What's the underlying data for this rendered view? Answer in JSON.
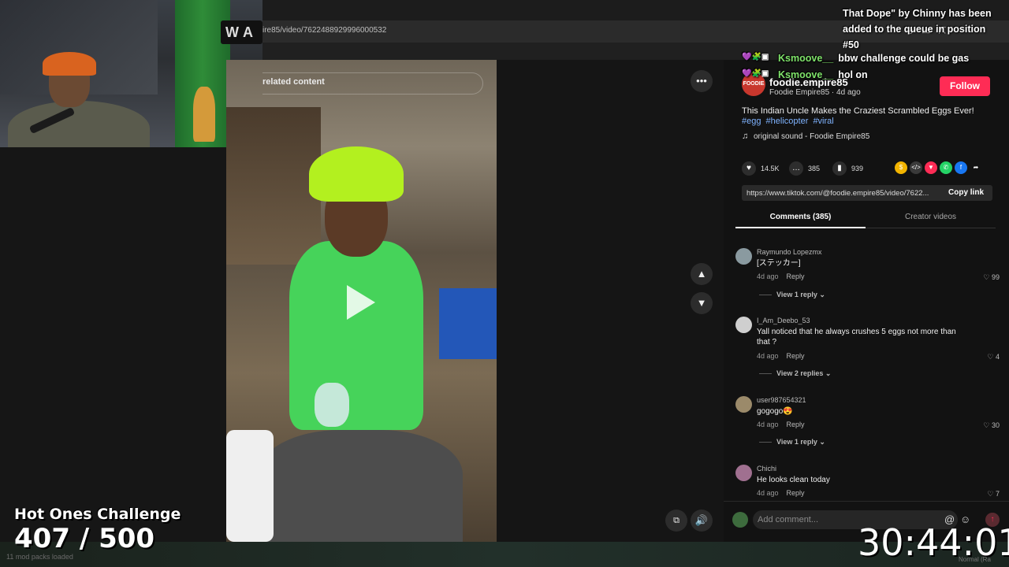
{
  "browser": {
    "url": "ire85/video/7622488929996000532"
  },
  "video": {
    "related_label": "related content",
    "more_label": "•••"
  },
  "stream_overlay": {
    "challenge_title": "Hot Ones Challenge",
    "challenge_count": "407 / 500",
    "mods_loaded": "11 mod packs loaded",
    "timer": "30:44:01",
    "normal_label": "Normal (Ra"
  },
  "chat": {
    "queue_message": "That Dope\" by Chinny has been added to the queue in position #50",
    "messages": [
      {
        "user": "Ksmoove__",
        "text": "bbw challenge could be gas"
      },
      {
        "user": "Ksmoove__",
        "text": "hol on"
      }
    ]
  },
  "creator": {
    "avatar_text": "FOODIE",
    "username": "foodie.empire85",
    "nickname_date": "Foodie Empire85 · 4d ago",
    "follow_label": "Follow"
  },
  "post": {
    "description": "This Indian Uncle Makes the Craziest Scrambled Eggs Ever!",
    "hashtags": [
      "#egg",
      "#helicopter",
      "#viral"
    ],
    "music": "original sound - Foodie Empire85",
    "likes": "14.5K",
    "comments": "385",
    "saves": "939",
    "link": "https://www.tiktok.com/@foodie.empire85/video/7622...",
    "copy_link_label": "Copy link"
  },
  "tabs": {
    "comments": "Comments (385)",
    "creator_videos": "Creator videos"
  },
  "comments": [
    {
      "user": "Raymundo Lopezmx",
      "text": "[ステッカー]",
      "date": "4d ago",
      "reply": "Reply",
      "likes": "99",
      "view_replies": "View 1 reply"
    },
    {
      "user": "I_Am_Deebo_53",
      "text": "Yall noticed that he always crushes 5 eggs not more than that ?",
      "date": "4d ago",
      "reply": "Reply",
      "likes": "4",
      "view_replies": "View 2 replies"
    },
    {
      "user": "user987654321",
      "text": "gogogo😍",
      "date": "4d ago",
      "reply": "Reply",
      "likes": "30",
      "view_replies": "View 1 reply"
    },
    {
      "user": "Chichi",
      "text": "He looks clean today",
      "date": "4d ago",
      "reply": "Reply",
      "likes": "7",
      "view_replies": ""
    }
  ],
  "comment_input": {
    "placeholder": "Add comment..."
  },
  "colors": {
    "follow": "#fe2c55",
    "hashtag": "#7fb3ff",
    "chat_user": "#7fe36a"
  }
}
